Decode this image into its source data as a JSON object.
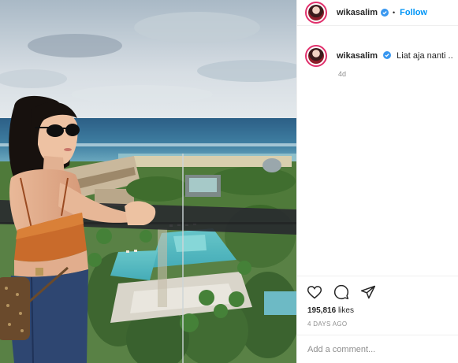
{
  "post": {
    "username": "wikasalim",
    "follow_label": "Follow",
    "separator": "•",
    "caption": "Liat aja nanti ..",
    "relative_time": "4d",
    "likes_count": "195,816",
    "likes_suffix": "likes",
    "posted_ago": "4 DAYS AGO",
    "comment_placeholder": "Add a comment..."
  },
  "icons": {
    "verified": "verified-badge-icon",
    "like": "heart-icon",
    "comment": "comment-bubble-icon",
    "share": "send-icon"
  },
  "colors": {
    "accent": "#0095f6",
    "avatar_ring": "#e1306c",
    "muted_text": "#8e8e8e",
    "divider": "#efefef"
  }
}
